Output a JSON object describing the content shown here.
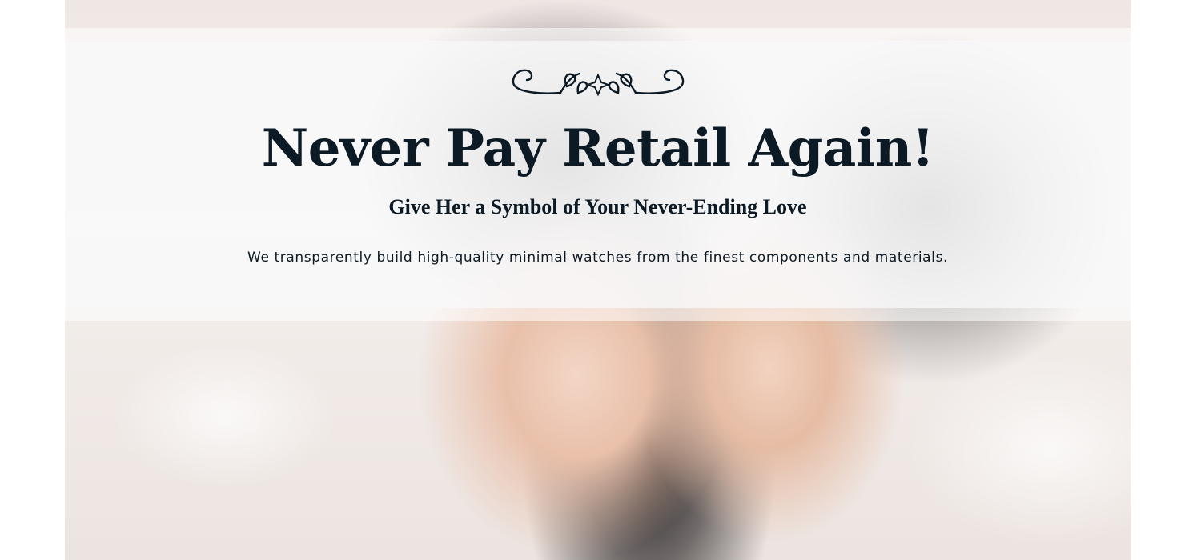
{
  "hero": {
    "ornament_icon": "flourish-ornament-icon",
    "headline": "Never Pay Retail Again!",
    "subheadline": "Give Her a Symbol of Your Never-Ending Love",
    "description": "We transparently build high-quality minimal watches from the finest components and materials."
  },
  "colors": {
    "text": "#0b1a24",
    "overlay": "#f8f8fa"
  }
}
